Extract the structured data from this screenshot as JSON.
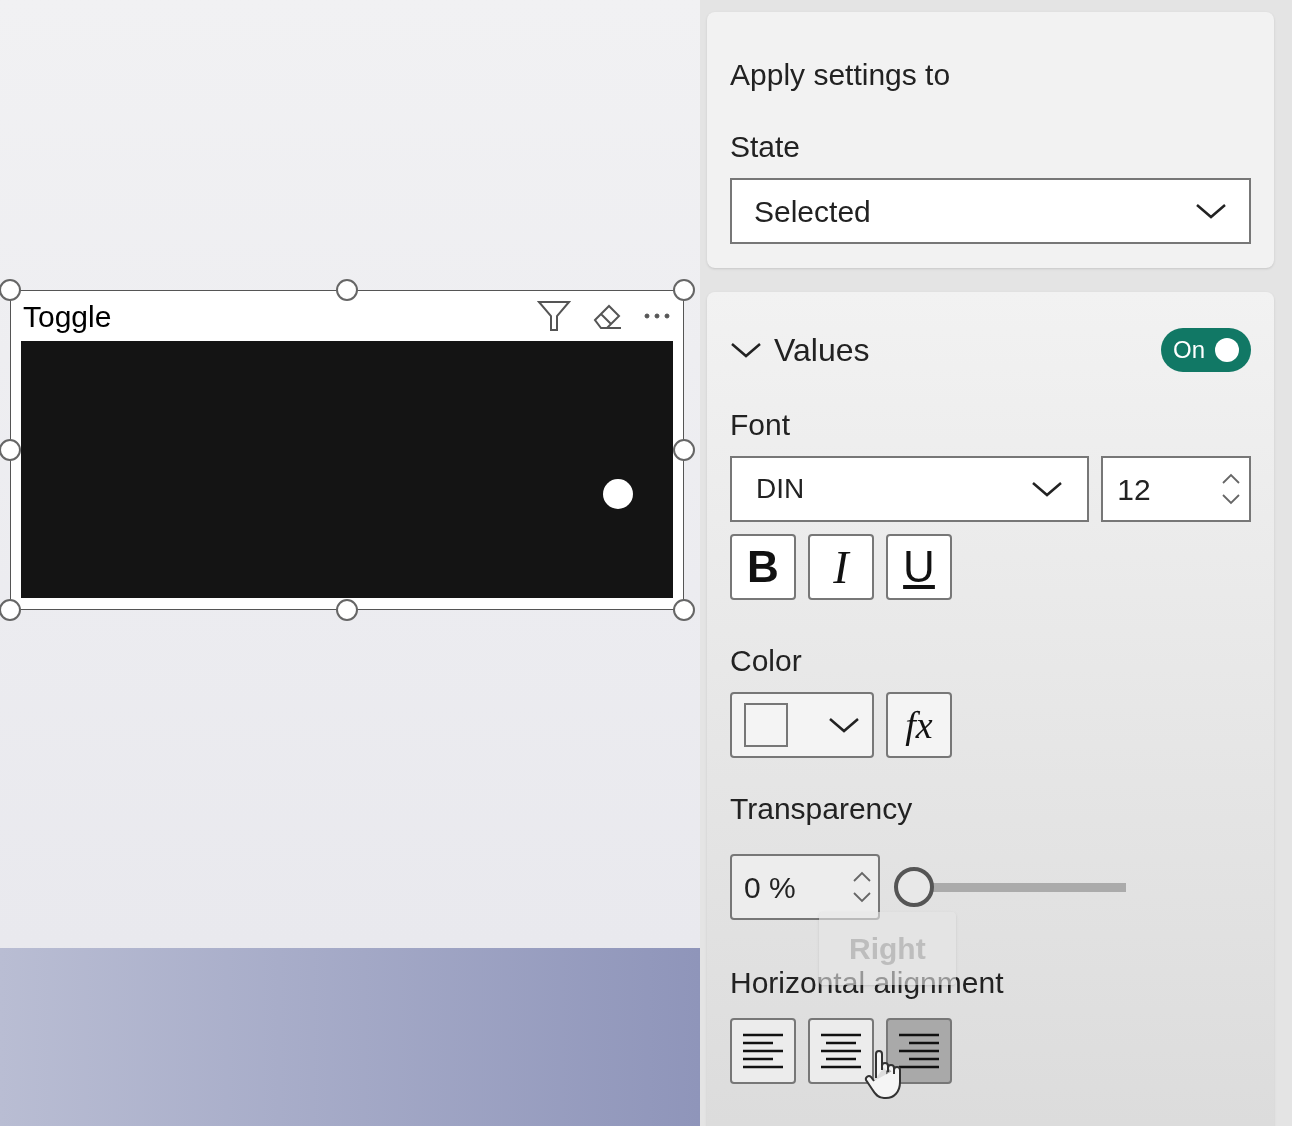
{
  "canvas": {
    "visual": {
      "title": "Toggle",
      "on": true
    }
  },
  "format_pane": {
    "apply_settings": {
      "heading": "Apply settings to",
      "state_label": "State",
      "state_value": "Selected"
    },
    "values": {
      "title": "Values",
      "expanded": true,
      "toggle": {
        "on": true,
        "label": "On"
      },
      "font_label": "Font",
      "font_family": "DIN",
      "font_size": "12",
      "styles": [
        {
          "kind": "bold",
          "label": "B"
        },
        {
          "kind": "italic",
          "label": "I"
        },
        {
          "kind": "underline",
          "label": "U"
        }
      ],
      "color_label": "Color",
      "fx_label": "fx",
      "transparency_label": "Transparency",
      "transparency": {
        "value": "0 %",
        "level": 0
      },
      "tooltip": "Right",
      "alignment_label": "Horizontal alignment",
      "alignments": [
        {
          "kind": "left",
          "selected": false
        },
        {
          "kind": "center",
          "selected": false
        },
        {
          "kind": "right",
          "selected": true
        }
      ]
    }
  }
}
